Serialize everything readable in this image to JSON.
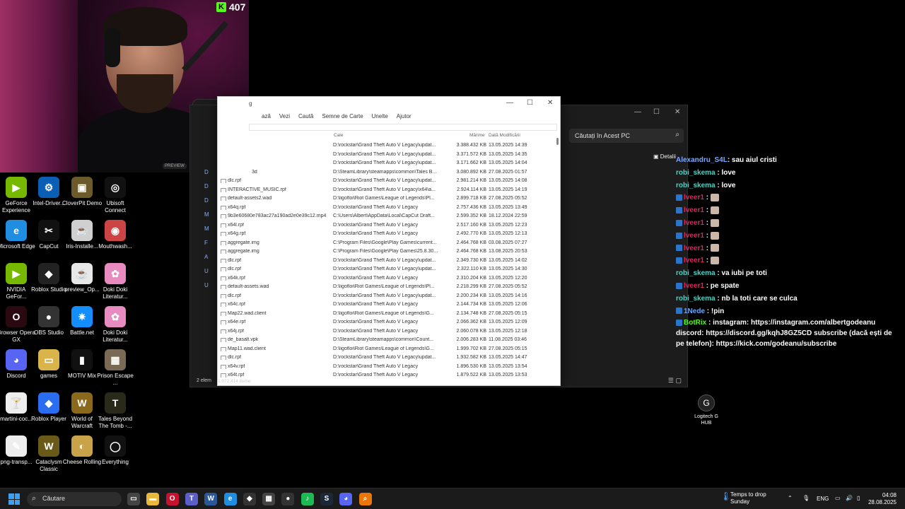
{
  "stream": {
    "viewer_count": "407",
    "cam_badge": "PREVIEW"
  },
  "desktop_icons": [
    {
      "label": "GeForce Experience",
      "color": "#76b900",
      "glyph": "▶",
      "col": 0,
      "row": 0
    },
    {
      "label": "Intel-Driver...",
      "color": "#0a5fb4",
      "glyph": "⚙",
      "col": 1,
      "row": 0
    },
    {
      "label": "CloverPit Demo",
      "color": "#6d5a2a",
      "glyph": "▣",
      "col": 2,
      "row": 0
    },
    {
      "label": "Ubisoft Connect",
      "color": "#111",
      "glyph": "◎",
      "col": 3,
      "row": 0
    },
    {
      "label": "Microsoft Edge",
      "color": "#1f8de0",
      "glyph": "e",
      "col": 0,
      "row": 1
    },
    {
      "label": "CapCut",
      "color": "#111",
      "glyph": "✂",
      "col": 1,
      "row": 1
    },
    {
      "label": "Iris-Installe...",
      "color": "#d0d0d0",
      "glyph": "☕",
      "col": 2,
      "row": 1
    },
    {
      "label": "Mouthwash...",
      "color": "#c44",
      "glyph": "◉",
      "col": 3,
      "row": 1
    },
    {
      "label": "NVIDIA GeFor...",
      "color": "#76b900",
      "glyph": "▶",
      "col": 0,
      "row": 2
    },
    {
      "label": "Roblox Studio",
      "color": "#222",
      "glyph": "◆",
      "col": 1,
      "row": 2
    },
    {
      "label": "preview_Op...",
      "color": "#e8e8e8",
      "glyph": "☕",
      "col": 2,
      "row": 2
    },
    {
      "label": "Doki Doki Literatur...",
      "color": "#e88bc0",
      "glyph": "✿",
      "col": 3,
      "row": 2
    },
    {
      "label": "Browser Opera GX",
      "color": "#2a0a10",
      "glyph": "O",
      "col": 0,
      "row": 3
    },
    {
      "label": "OBS Studio",
      "color": "#333",
      "glyph": "●",
      "col": 1,
      "row": 3
    },
    {
      "label": "Battle.net",
      "color": "#148eff",
      "glyph": "✷",
      "col": 2,
      "row": 3
    },
    {
      "label": "Doki Doki Literatur...",
      "color": "#e88bc0",
      "glyph": "✿",
      "col": 3,
      "row": 3
    },
    {
      "label": "Discord",
      "color": "#5865f2",
      "glyph": "◕",
      "col": 0,
      "row": 4
    },
    {
      "label": "games",
      "color": "#d8b44a",
      "glyph": "▭",
      "col": 1,
      "row": 4
    },
    {
      "label": "MOTIV Mix",
      "color": "#111",
      "glyph": "▮",
      "col": 2,
      "row": 4
    },
    {
      "label": "Prison Escape ...",
      "color": "#7a6a55",
      "glyph": "▦",
      "col": 3,
      "row": 4
    },
    {
      "label": "martini-coc...",
      "color": "#eee",
      "glyph": "🍸",
      "col": 0,
      "row": 5
    },
    {
      "label": "Roblox Player",
      "color": "#2b6df0",
      "glyph": "◆",
      "col": 1,
      "row": 5
    },
    {
      "label": "World of Warcraft",
      "color": "#8a6a1a",
      "glyph": "W",
      "col": 2,
      "row": 5
    },
    {
      "label": "Tales Beyond The Tomb -...",
      "color": "#2a2a1a",
      "glyph": "T",
      "col": 3,
      "row": 5
    },
    {
      "label": "png-transp...",
      "color": "#eee",
      "glyph": "✎",
      "col": 0,
      "row": 6
    },
    {
      "label": "Cataclysm Classic",
      "color": "#6a5a1a",
      "glyph": "W",
      "col": 1,
      "row": 6
    },
    {
      "label": "Cheese Rolling",
      "color": "#c9a34a",
      "glyph": "◐",
      "col": 2,
      "row": 6
    },
    {
      "label": "Everything",
      "color": "#111",
      "glyph": "◯",
      "col": 3,
      "row": 6
    }
  ],
  "explorer_back": {
    "search_placeholder": "Căutați în Acest PC",
    "details_label": "Detalii",
    "status": "2 elem",
    "minimize": "—",
    "maximize": "☐",
    "close": "✕",
    "side_letters": [
      "D",
      "D",
      "D",
      "M",
      "M",
      "F",
      "A",
      "U",
      "U"
    ]
  },
  "search_window": {
    "title": "g",
    "menu": [
      "ază",
      "Vezi",
      "Caută",
      "Semne de Carte",
      "Unelte",
      "Ajutor"
    ],
    "columns": {
      "path": "Cale",
      "size": "Mărime",
      "date": "Dată Modificării"
    },
    "status": "1.072.414 iteme",
    "minimize": "—",
    "maximize": "☐",
    "close": "✕",
    "partial_row": "3d",
    "rows": [
      {
        "name": "",
        "path": "D:\\rockstar\\Grand Theft Auto V Legacy\\updat...",
        "size": "3.388.432 KB",
        "date": "13.05.2025 14:39"
      },
      {
        "name": "",
        "path": "D:\\rockstar\\Grand Theft Auto V Legacy\\updat...",
        "size": "3.371.572 KB",
        "date": "13.05.2025 14:35"
      },
      {
        "name": "",
        "path": "D:\\rockstar\\Grand Theft Auto V Legacy\\updat...",
        "size": "3.171.662 KB",
        "date": "13.05.2025 14:04"
      },
      {
        "name": "",
        "path": "D:\\SteamLibrary\\steamapps\\common\\Tales B...",
        "size": "3.080.892 KB",
        "date": "27.08.2025 01:57"
      },
      {
        "name": "dlc.rpf",
        "path": "D:\\rockstar\\Grand Theft Auto V Legacy\\updat...",
        "size": "2.981.214 KB",
        "date": "13.05.2025 14:08"
      },
      {
        "name": "INTERACTIVE_MUSIC.rpf",
        "path": "D:\\rockstar\\Grand Theft Auto V Legacy\\x64\\a...",
        "size": "2.924.114 KB",
        "date": "13.05.2025 14:19"
      },
      {
        "name": "default-assets2.wad",
        "path": "D:\\ligofloi\\Riot Games\\League of Legends\\Pl...",
        "size": "2.899.718 KB",
        "date": "27.08.2025 05:52"
      },
      {
        "name": "x64q.rpf",
        "path": "D:\\rockstar\\Grand Theft Auto V Legacy",
        "size": "2.757.436 KB",
        "date": "13.05.2025 13:49"
      },
      {
        "name": "9b3e60680e783ac27a190ad2e0e39c12.mp4",
        "path": "C:\\Users\\Albert\\AppData\\Local\\CapCut Draft...",
        "size": "2.599.352 KB",
        "date": "18.12.2024 22:59"
      },
      {
        "name": "x64l.rpf",
        "path": "D:\\rockstar\\Grand Theft Auto V Legacy",
        "size": "2.517.160 KB",
        "date": "13.05.2025 12:23"
      },
      {
        "name": "x64g.rpf",
        "path": "D:\\rockstar\\Grand Theft Auto V Legacy",
        "size": "2.492.770 KB",
        "date": "13.05.2025 12:13"
      },
      {
        "name": "aggregate.img",
        "path": "C:\\Program Files\\Google\\Play Games\\current...",
        "size": "2.464.768 KB",
        "date": "03.08.2025 07:27"
      },
      {
        "name": "aggregate.img",
        "path": "C:\\Program Files\\Google\\Play Games\\25.8.30...",
        "size": "2.464.768 KB",
        "date": "13.08.2025 20:53"
      },
      {
        "name": "dlc.rpf",
        "path": "D:\\rockstar\\Grand Theft Auto V Legacy\\updat...",
        "size": "2.349.730 KB",
        "date": "13.05.2025 14:02"
      },
      {
        "name": "dlc.rpf",
        "path": "D:\\rockstar\\Grand Theft Auto V Legacy\\updat...",
        "size": "2.322.110 KB",
        "date": "13.05.2025 14:30"
      },
      {
        "name": "x64k.rpf",
        "path": "D:\\rockstar\\Grand Theft Auto V Legacy",
        "size": "2.310.204 KB",
        "date": "13.05.2025 12:20"
      },
      {
        "name": "default-assets.wad",
        "path": "D:\\ligofloi\\Riot Games\\League of Legends\\Pl...",
        "size": "2.218.299 KB",
        "date": "27.08.2025 05:52"
      },
      {
        "name": "dlc.rpf",
        "path": "D:\\rockstar\\Grand Theft Auto V Legacy\\updat...",
        "size": "2.200.234 KB",
        "date": "13.05.2025 14:16"
      },
      {
        "name": "x64c.rpf",
        "path": "D:\\rockstar\\Grand Theft Auto V Legacy",
        "size": "2.144.734 KB",
        "date": "13.05.2025 12:06"
      },
      {
        "name": "Map22.wad.client",
        "path": "D:\\ligofloi\\Riot Games\\League of Legends\\G...",
        "size": "2.134.748 KB",
        "date": "27.08.2025 05:15"
      },
      {
        "name": "x64e.rpf",
        "path": "D:\\rockstar\\Grand Theft Auto V Legacy",
        "size": "2.066.362 KB",
        "date": "13.05.2025 12:09"
      },
      {
        "name": "x64j.rpf",
        "path": "D:\\rockstar\\Grand Theft Auto V Legacy",
        "size": "2.060.078 KB",
        "date": "13.05.2025 12:18"
      },
      {
        "name": "de_basalt.vpk",
        "path": "D:\\SteamLibrary\\steamapps\\common\\Count...",
        "size": "2.006.283 KB",
        "date": "11.08.2025 03:46"
      },
      {
        "name": "Map11.wad.client",
        "path": "D:\\ligofloi\\Riot Games\\League of Legends\\G...",
        "size": "1.999.702 KB",
        "date": "27.08.2025 05:15"
      },
      {
        "name": "dlc.rpf",
        "path": "D:\\rockstar\\Grand Theft Auto V Legacy\\updat...",
        "size": "1.932.582 KB",
        "date": "13.05.2025 14:47"
      },
      {
        "name": "x64v.rpf",
        "path": "D:\\rockstar\\Grand Theft Auto V Legacy",
        "size": "1.896.530 KB",
        "date": "13.05.2025 13:54"
      },
      {
        "name": "x64t.rpf",
        "path": "D:\\rockstar\\Grand Theft Auto V Legacy",
        "size": "1.879.522 KB",
        "date": "13.05.2025 13:53"
      }
    ]
  },
  "chat": [
    {
      "user": "Alexandru_S4L",
      "color": "#7aa7ff",
      "text": ": sau aiul cristi",
      "badge": false,
      "emote": false
    },
    {
      "user": "robi_skema",
      "color": "#4fd1c5",
      "text": " : love",
      "badge": false,
      "emote": false
    },
    {
      "user": "robi_skema",
      "color": "#4fd1c5",
      "text": " : love",
      "badge": false,
      "emote": false
    },
    {
      "user": "lveer1",
      "color": "#e0245e",
      "text": " : ",
      "badge": true,
      "emote": true
    },
    {
      "user": "lveer1",
      "color": "#e0245e",
      "text": " : ",
      "badge": true,
      "emote": true
    },
    {
      "user": "lveer1",
      "color": "#e0245e",
      "text": " : ",
      "badge": true,
      "emote": true
    },
    {
      "user": "lveer1",
      "color": "#e0245e",
      "text": " : ",
      "badge": true,
      "emote": true
    },
    {
      "user": "lveer1",
      "color": "#e0245e",
      "text": " : ",
      "badge": true,
      "emote": true
    },
    {
      "user": "lveer1",
      "color": "#e0245e",
      "text": " : ",
      "badge": true,
      "emote": true
    },
    {
      "user": "robi_skema",
      "color": "#4fd1c5",
      "text": " : va iubi pe toti",
      "badge": false,
      "emote": false
    },
    {
      "user": "lveer1",
      "color": "#e0245e",
      "text": " : pe spate",
      "badge": true,
      "emote": false
    },
    {
      "user": "robi_skema",
      "color": "#4fd1c5",
      "text": " : nb la toti care se culca",
      "badge": false,
      "emote": false
    },
    {
      "user": "1Nede",
      "color": "#6aa8ff",
      "text": " : !pin",
      "badge": true,
      "emote": false
    }
  ],
  "bot_message": {
    "user": "BotRix",
    "color": "#53fc18",
    "text": " : instagram: https://instagram.com/albertgodeanu discord: https://discord.gg/kqhJ8GZ5CD subscribe (dacă ești de pe telefon): https://kick.com/godeanu/subscribe"
  },
  "logitech": {
    "label": "Logitech G HUB"
  },
  "ghost_text": "",
  "taskbar": {
    "search_placeholder": "Căutare",
    "apps": [
      {
        "name": "task-view",
        "color": "#444",
        "glyph": "▭"
      },
      {
        "name": "file-explorer",
        "color": "#e8b83c",
        "glyph": "▬"
      },
      {
        "name": "opera-gx",
        "color": "#c4122f",
        "glyph": "O"
      },
      {
        "name": "teams",
        "color": "#5b5fc7",
        "glyph": "T"
      },
      {
        "name": "word",
        "color": "#2b5797",
        "glyph": "W"
      },
      {
        "name": "edge",
        "color": "#1f8de0",
        "glyph": "e"
      },
      {
        "name": "unity",
        "color": "#333",
        "glyph": "◆"
      },
      {
        "name": "store",
        "color": "#444",
        "glyph": "▦"
      },
      {
        "name": "obs",
        "color": "#333",
        "glyph": "●"
      },
      {
        "name": "spotify",
        "color": "#1db954",
        "glyph": "♪"
      },
      {
        "name": "steam",
        "color": "#1b2838",
        "glyph": "S"
      },
      {
        "name": "discord",
        "color": "#5865f2",
        "glyph": "◕"
      },
      {
        "name": "everything",
        "color": "#e8760a",
        "glyph": "⌕"
      }
    ],
    "weather_line1": "Temps to drop",
    "weather_line2": "Sunday",
    "language": "ENG",
    "time": "04:08",
    "date": "28.08.2025"
  }
}
